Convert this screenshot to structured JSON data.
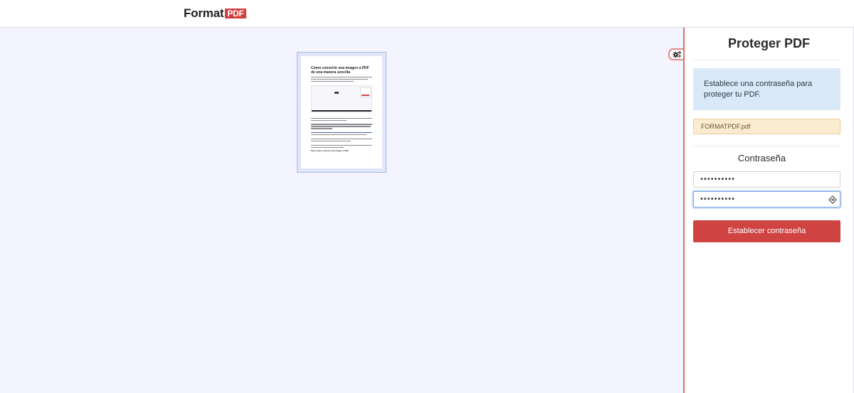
{
  "header": {
    "logo_text": "Format",
    "logo_badge": "PDF"
  },
  "thumbnail": {
    "title": "Cómo convertir una imagen a PDF de una manera sencilla",
    "subheading": "Pasos para convertir una imagen a PDF"
  },
  "panel": {
    "title": "Proteger PDF",
    "info": "Establece una contraseña para proteger tu PDF.",
    "file_name": "FORMATPDF.pdf",
    "section_title": "Contraseña",
    "password_value": "••••••••••",
    "confirm_value": "••••••••••",
    "submit_label": "Establecer contraseña"
  },
  "colors": {
    "accent": "#cf4343",
    "info_bg": "#d9e9f7",
    "file_bg": "#faecd0",
    "workspace_bg": "#f3f4fd"
  },
  "icons": {
    "gear": "gears-icon",
    "reveal": "key-reveal-icon"
  }
}
